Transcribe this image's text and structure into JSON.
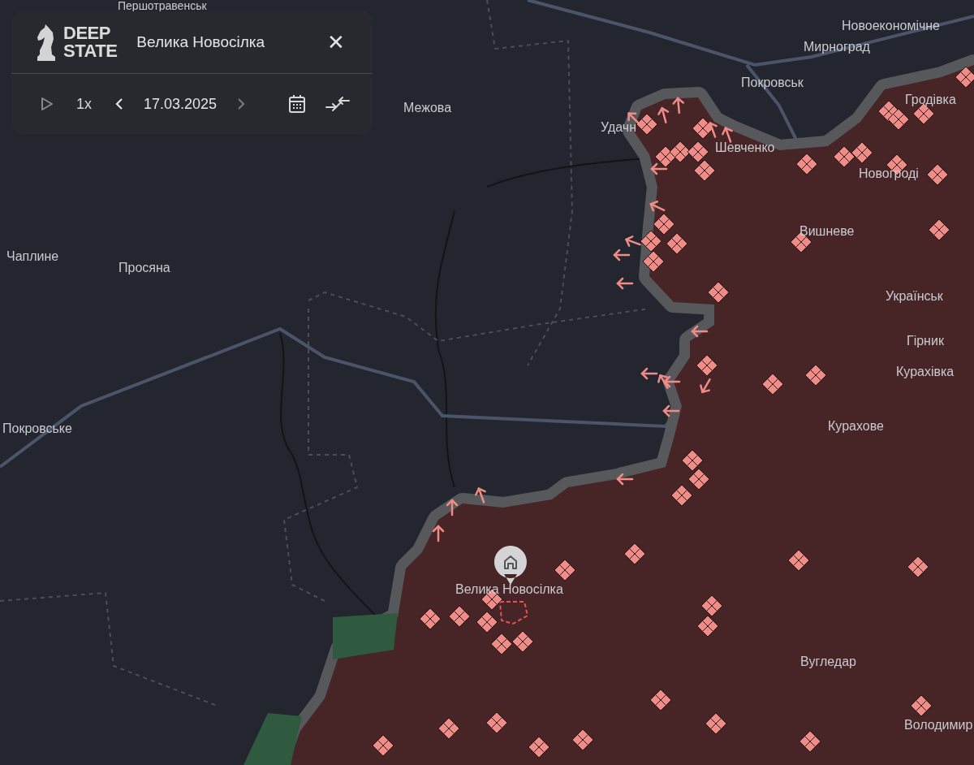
{
  "panel": {
    "logo": [
      "DEEP",
      "STATE"
    ],
    "title": "Велика Новосілка",
    "close": "✕",
    "playing": false,
    "speed": "1x",
    "date": "17.03.2025",
    "prev": {
      "disabled": false
    },
    "next": {
      "disabled": true
    }
  },
  "map": {
    "places": [
      {
        "name": "Першотравенськ"
      },
      {
        "name": "Новоекономічне"
      },
      {
        "name": "Мирноград"
      },
      {
        "name": "Покровськ"
      },
      {
        "name": "Межова"
      },
      {
        "name": "Гродівка"
      },
      {
        "name": "Удачн"
      },
      {
        "name": "Шевченко"
      },
      {
        "name": "Новогроді"
      },
      {
        "name": "Вишневе"
      },
      {
        "name": "Чаплине"
      },
      {
        "name": "Просяна"
      },
      {
        "name": "Українськ"
      },
      {
        "name": "Гірник"
      },
      {
        "name": "Курахівка"
      },
      {
        "name": "Покровське"
      },
      {
        "name": "Курахове"
      },
      {
        "name": "Велика Новосілка"
      },
      {
        "name": "Вугледар"
      },
      {
        "name": "Володимир"
      }
    ]
  }
}
